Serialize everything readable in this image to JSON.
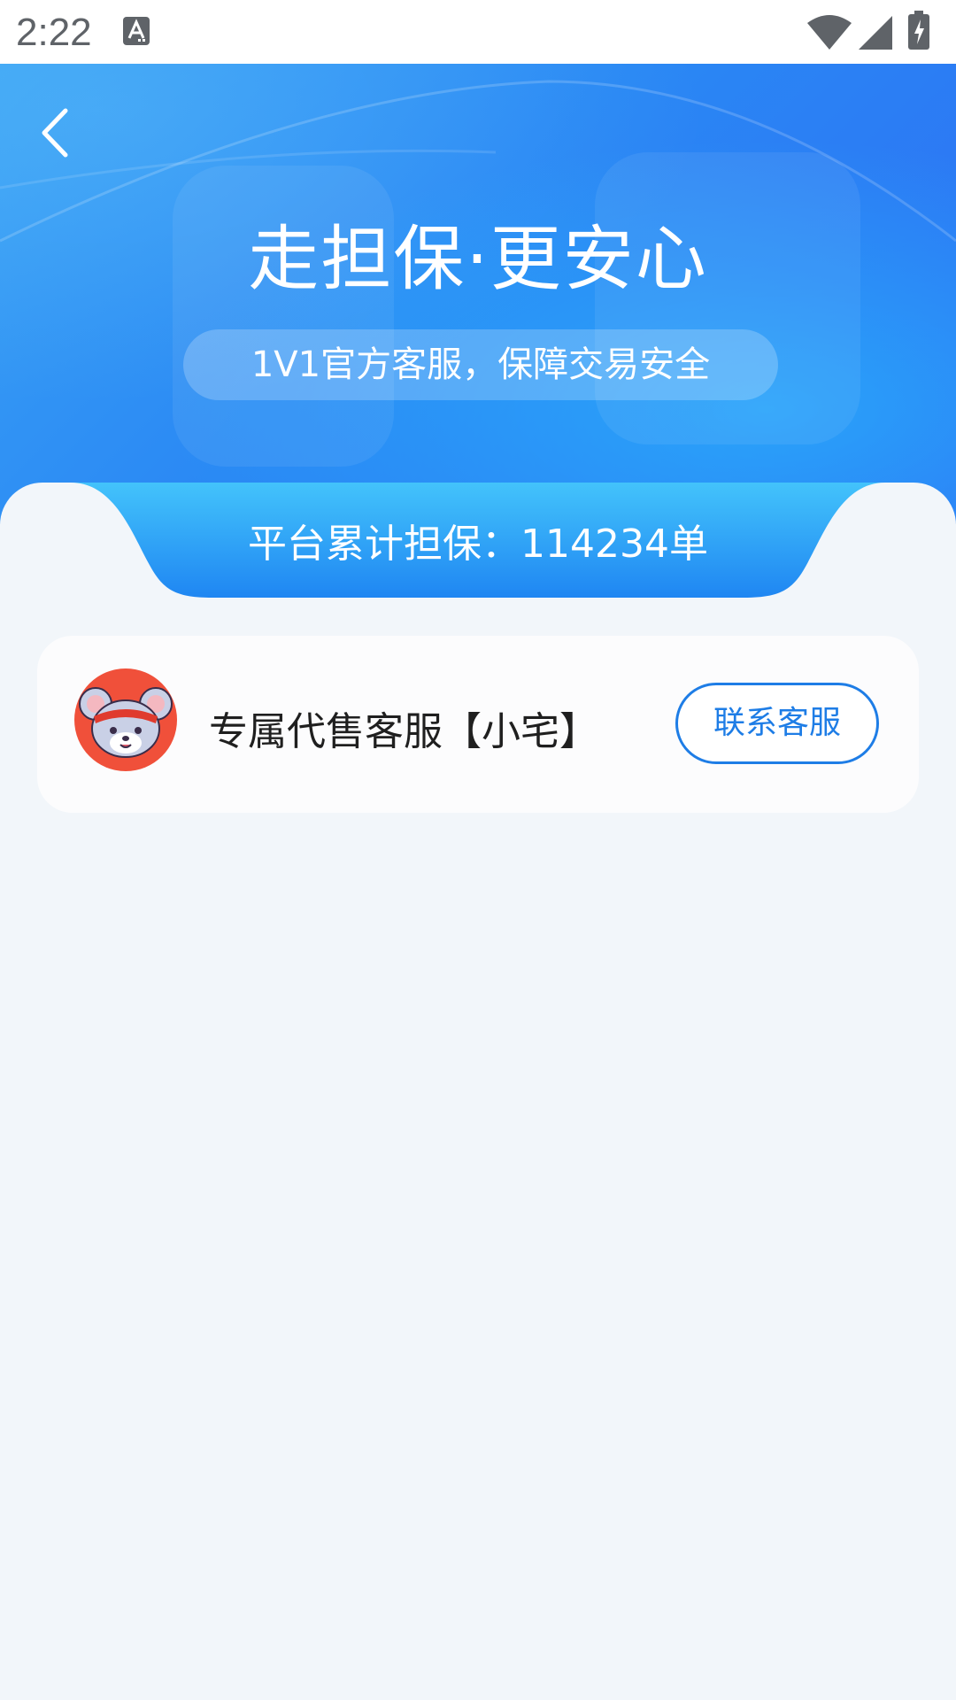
{
  "status_bar": {
    "time": "2:22",
    "icons": [
      "a-notification-icon",
      "wifi-icon",
      "cellular-signal-icon",
      "battery-charging-icon"
    ]
  },
  "header": {
    "back_icon": "back-arrow-icon",
    "title": "走担保·更安心",
    "subtitle": "1V1官方客服，保障交易安全"
  },
  "stats": {
    "text": "平台累计担保：114234单"
  },
  "agent_card": {
    "avatar_icon": "mouse-avatar-icon",
    "name": "专属代售客服【小宅】",
    "contact_label": "联系客服"
  },
  "colors": {
    "accent_blue": "#1e7de6",
    "hero_gradient_start": "#3aa2f4",
    "hero_gradient_end": "#2d6df4",
    "page_background": "#f2f6fa",
    "avatar_background": "#f0503a"
  }
}
